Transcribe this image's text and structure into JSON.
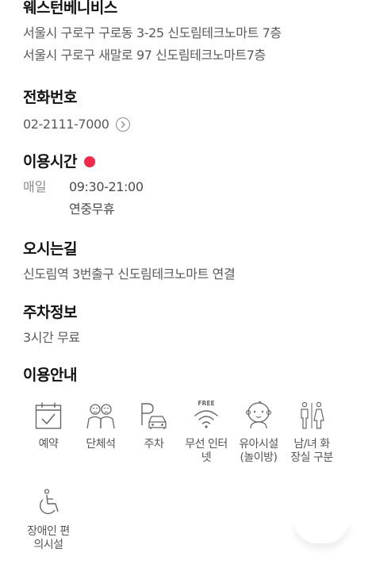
{
  "store": {
    "name": "웨스턴베니비스",
    "address_lines": [
      "서울시 구로구 구로동 3-25 신도림테크노마트 7층",
      "서울시 구로구 새말로 97 신도림테크노마트7층"
    ]
  },
  "phone": {
    "title": "전화번호",
    "number": "02-2111-7000"
  },
  "hours": {
    "title": "이용시간",
    "status_color": "#f0284a",
    "day": "매일",
    "time": "09:30-21:00",
    "note": "연중무휴"
  },
  "directions": {
    "title": "오시는길",
    "text": "신도림역 3번출구 신도림테크노마트 연결"
  },
  "parking": {
    "title": "주차정보",
    "text": "3시간 무료"
  },
  "amenities": {
    "title": "이용안내",
    "items": [
      {
        "icon": "calendar-check-icon",
        "label_lines": [
          "예약"
        ]
      },
      {
        "icon": "group-seat-icon",
        "label_lines": [
          "단체석"
        ]
      },
      {
        "icon": "parking-car-icon",
        "label_lines": [
          "주차"
        ]
      },
      {
        "icon": "free-wifi-icon",
        "icon_text": "FREE",
        "label_lines": [
          "무선 인터",
          "넷"
        ]
      },
      {
        "icon": "baby-face-icon",
        "label_lines": [
          "유아시설",
          "(놀이방)"
        ]
      },
      {
        "icon": "restroom-icon",
        "label_lines": [
          "남/녀 화",
          "장실 구분"
        ]
      },
      {
        "icon": "wheelchair-icon",
        "label_lines": [
          "장애인 편",
          "의시설"
        ]
      }
    ]
  }
}
